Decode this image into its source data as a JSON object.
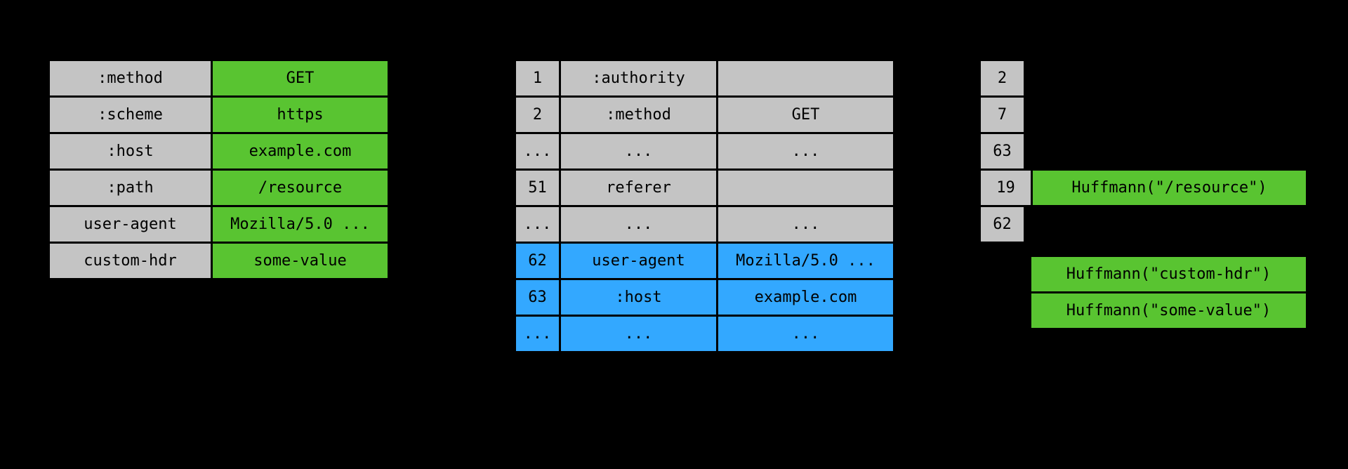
{
  "headers": [
    {
      "name": ":method",
      "value": "GET"
    },
    {
      "name": ":scheme",
      "value": "https"
    },
    {
      "name": ":host",
      "value": "example.com"
    },
    {
      "name": ":path",
      "value": "/resource"
    },
    {
      "name": "user-agent",
      "value": "Mozilla/5.0 ..."
    },
    {
      "name": "custom-hdr",
      "value": "some-value"
    }
  ],
  "table": {
    "static": [
      {
        "index": "1",
        "name": ":authority",
        "value": ""
      },
      {
        "index": "2",
        "name": ":method",
        "value": "GET"
      },
      {
        "index": "...",
        "name": "...",
        "value": "..."
      },
      {
        "index": "51",
        "name": "referer",
        "value": ""
      },
      {
        "index": "...",
        "name": "...",
        "value": "..."
      }
    ],
    "dynamic": [
      {
        "index": "62",
        "name": "user-agent",
        "value": "Mozilla/5.0 ..."
      },
      {
        "index": "63",
        "name": ":host",
        "value": "example.com"
      },
      {
        "index": "...",
        "name": "...",
        "value": "..."
      }
    ]
  },
  "encoded": {
    "indexed": [
      "2",
      "7",
      "63"
    ],
    "literal_indexed": {
      "index": "19",
      "huff": "Huffmann(\"/resource\")"
    },
    "indexed2": [
      "62"
    ],
    "literals": [
      "Huffmann(\"custom-hdr\")",
      "Huffmann(\"some-value\")"
    ]
  }
}
